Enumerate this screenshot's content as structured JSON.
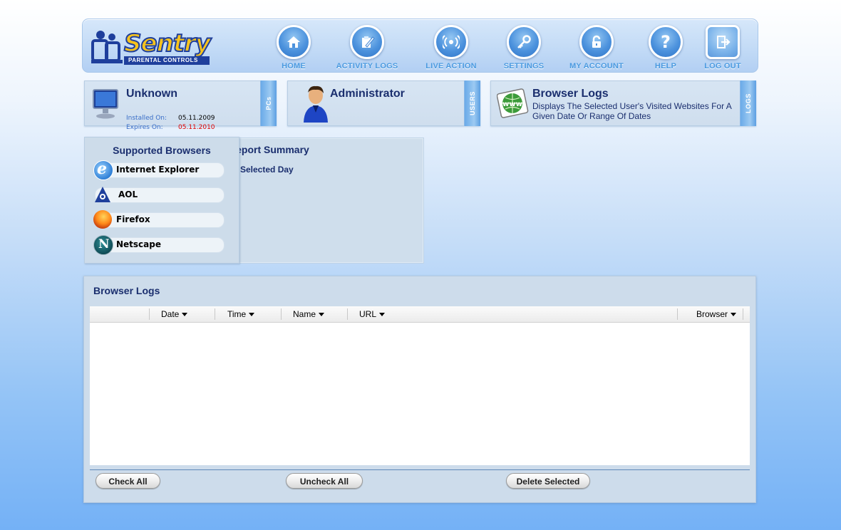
{
  "app": {
    "logo_text": "Sentry",
    "logo_subtext": "PARENTAL CONTROLS"
  },
  "nav": [
    {
      "label": "HOME",
      "icon": "home-icon"
    },
    {
      "label": "ACTIVITY LOGS",
      "icon": "clipboard-pencil-icon"
    },
    {
      "label": "LIVE ACTION",
      "icon": "signal-icon"
    },
    {
      "label": "SETTINGS",
      "icon": "key-icon"
    },
    {
      "label": "MY ACCOUNT",
      "icon": "padlock-icon"
    },
    {
      "label": "HELP",
      "icon": "question-icon"
    },
    {
      "label": "LOG OUT",
      "icon": "logout-icon"
    }
  ],
  "pc_panel": {
    "title": "Unknown",
    "installed_label": "Installed On:",
    "installed_value": "05.11.2009",
    "expires_label": "Expires On:",
    "expires_value": "05.11.2010",
    "tab": "PCs"
  },
  "user_panel": {
    "title": "Administrator",
    "tab": "USERS"
  },
  "logs_panel": {
    "title": "Browser Logs",
    "description_line1": "Displays The Selected User's Visited Websites For A",
    "description_line2": "Given Date Or Range Of Dates",
    "tab": "LOGS",
    "icon_text": "www"
  },
  "supported_browsers": {
    "title": "Supported Browsers",
    "items": [
      "Internet Explorer",
      "AOL",
      "Firefox",
      "Netscape"
    ]
  },
  "report_summary": {
    "title": "Report Summary",
    "selected_day": "Selected Day"
  },
  "browser_logs": {
    "title": "Browser Logs",
    "columns": [
      "Date",
      "Time",
      "Name",
      "URL",
      "Browser"
    ],
    "rows": [],
    "buttons": {
      "check_all": "Check All",
      "uncheck_all": "Uncheck All",
      "delete_selected": "Delete Selected"
    }
  },
  "colors": {
    "nav_label": "#4a9ae0",
    "title_navy": "#1a2e6e",
    "expires_red": "#e00000"
  }
}
